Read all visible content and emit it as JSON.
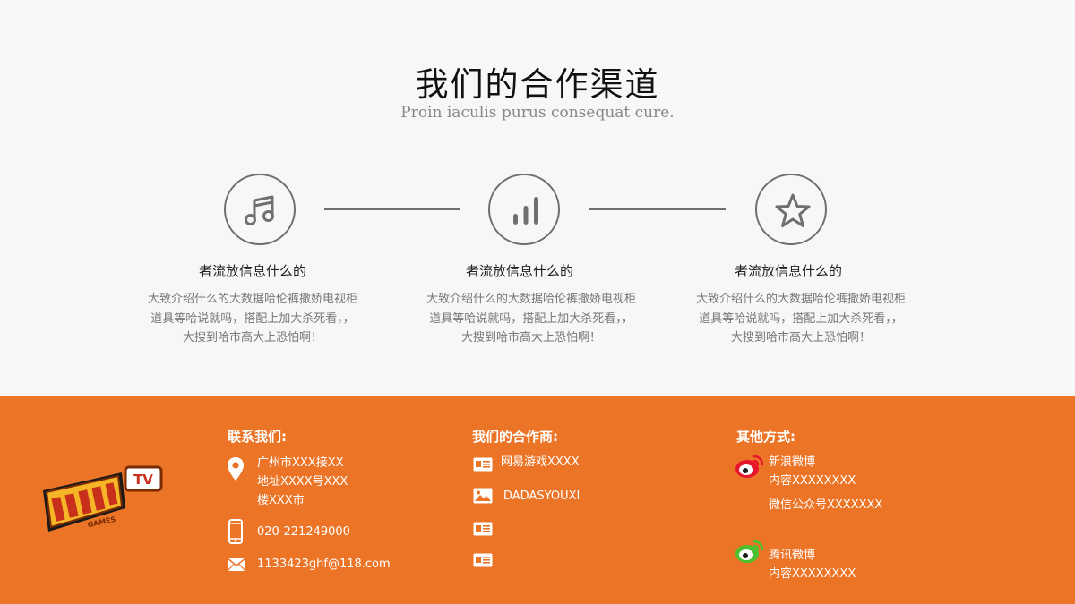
{
  "header": {
    "title": "我们的合作渠道",
    "subtitle": "Proin iaculis purus consequat cure."
  },
  "features": [
    {
      "icon": "music-note-icon",
      "title": "者流放信息什么的",
      "desc": [
        "大致介绍什么的大数据哈伦裤撒娇电视柜",
        "道具等哈说就吗，搭配上加大杀死看，，",
        "大搜到哈市高大上恐怕啊！"
      ]
    },
    {
      "icon": "bar-chart-icon",
      "title": "者流放信息什么的",
      "desc": [
        "大致介绍什么的大数据哈伦裤撒娇电视柜",
        "道具等哈说就吗，搭配上加大杀死看，，",
        "大搜到哈市高大上恐怕啊！"
      ]
    },
    {
      "icon": "star-icon",
      "title": "者流放信息什么的",
      "desc": [
        "大致介绍什么的大数据哈伦裤撒娇电视柜",
        "道具等哈说就吗，搭配上加大杀死看，，",
        "大搜到哈市高大上恐怕啊！"
      ]
    }
  ],
  "footer": {
    "logo_text": "TV",
    "logo_sub": "GAMES",
    "contact": {
      "title": "联系我们:",
      "address": [
        "广州市XXX接XX",
        "地址XXXX号XXX",
        "楼XXX市"
      ],
      "phone": "020-221249000",
      "email": "1133423ghf@118.com"
    },
    "partners": {
      "title": "我们的合作商:",
      "items": [
        "网易游戏XXXX",
        "DADASYOUXI",
        "",
        ""
      ]
    },
    "other": {
      "title": "其他方式:",
      "sina": [
        "新浪微博",
        "内容XXXXXXXX"
      ],
      "wechat": "微信公众号XXXXXXX",
      "tencent": [
        "腾讯微博",
        "内容XXXXXXXX"
      ]
    }
  },
  "colors": {
    "footer_bg": "#ec7426",
    "icon_gray": "#6f6f6f",
    "weibo_red": "#e6162d",
    "weibo_green": "#4cc02f"
  }
}
